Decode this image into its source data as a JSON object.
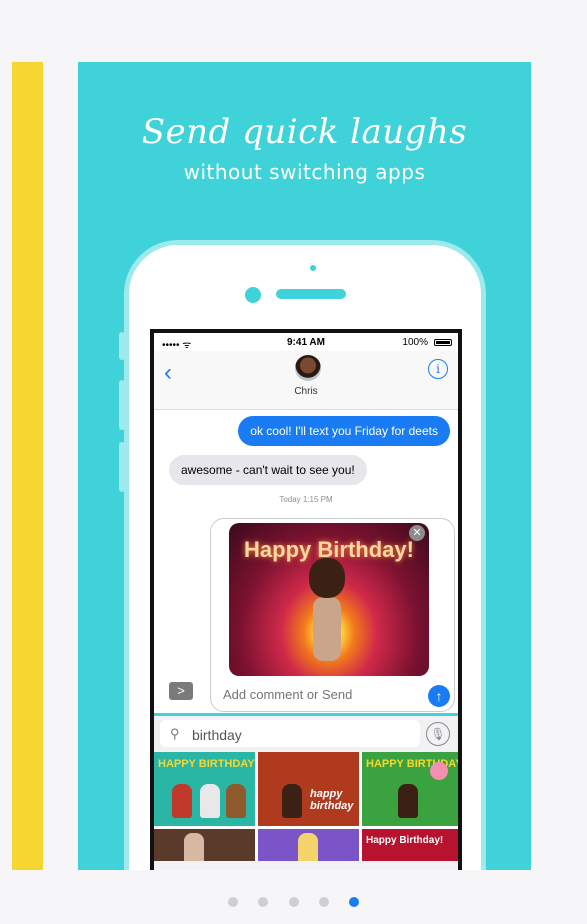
{
  "promo": {
    "headline": "Send quick laughs",
    "subhead": "without switching apps"
  },
  "status_bar": {
    "signal": "••••• ᯤ",
    "time": "9:41 AM",
    "battery": "100%"
  },
  "nav": {
    "back_glyph": "‹",
    "contact_name": "Chris",
    "info_glyph": "i"
  },
  "messages": {
    "outgoing": "ok cool! I'll text you Friday for deets",
    "incoming": "awesome - can't wait to see you!",
    "timestamp": "Today 1:15 PM"
  },
  "compose": {
    "gif_title": "Happy Birthday!",
    "remove_glyph": "✕",
    "placeholder": "Add comment or Send",
    "send_glyph": "↑",
    "apps_glyph": ">"
  },
  "search": {
    "icon_glyph": "⚲",
    "value": "birthday",
    "mic_glyph": "🎙"
  },
  "gif_results": [
    {
      "label": "HAPPY BIRTHDAY"
    },
    {
      "label": "happy birthday"
    },
    {
      "label": "HAPPY BIRTHDAY"
    },
    {
      "label": ""
    },
    {
      "label": ""
    },
    {
      "label": "Happy Birthday!"
    }
  ],
  "keyboard": {
    "page_dots": "●●●●●●●●"
  },
  "carousel": {
    "count": 5,
    "active_index": 4
  },
  "colors": {
    "accent": "#1a7cf5",
    "teal": "#3fd3d9",
    "yellow": "#f7d631"
  }
}
